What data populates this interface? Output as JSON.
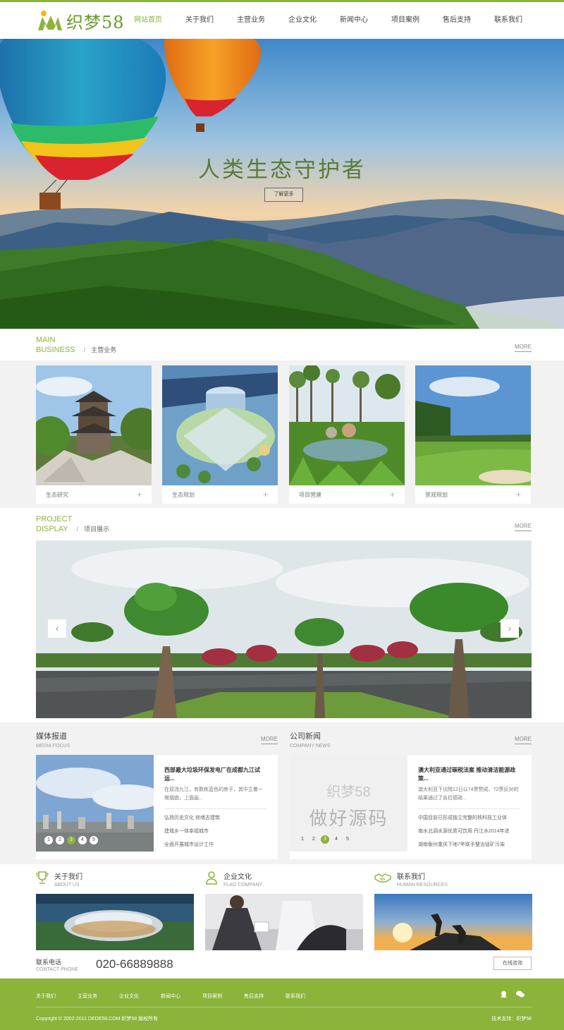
{
  "header": {
    "logo_text": "织梦58",
    "nav": [
      "网站首页",
      "关于我们",
      "主营业务",
      "企业文化",
      "新闻中心",
      "项目案例",
      "售后支持",
      "联系我们"
    ]
  },
  "hero": {
    "title": "人类生态守护者",
    "button": "了解更多"
  },
  "business": {
    "en_line1": "MAIN",
    "en_line2": "BUSINESS",
    "sep": "/",
    "cn": "主营业务",
    "more": "MORE",
    "cards": [
      {
        "label": "生态研究",
        "plus": "+"
      },
      {
        "label": "生态规划",
        "plus": "+"
      },
      {
        "label": "项目营建",
        "plus": "+"
      },
      {
        "label": "景观规划",
        "plus": "+"
      }
    ]
  },
  "project": {
    "en_line1": "PROJECT",
    "en_line2": "DISPLAY",
    "sep": "/",
    "cn": "项目展示",
    "more": "MORE",
    "prev": "‹",
    "next": "›"
  },
  "media": {
    "title": "媒体报道",
    "en": "MEDIA FOCUS",
    "more": "MORE",
    "pages": [
      "1",
      "2",
      "3",
      "4",
      "5"
    ],
    "headline": "西部最大垃圾环保发电厂在成都九江试运...",
    "desc": "在双流九江，有数栋蓝色的房子，其中立着一根烟囱，上面画...",
    "list": [
      "弘扬历史文化 修缮古建筑",
      "建城乡一体幸福城市",
      "全面开展城市设计工作"
    ]
  },
  "company_news": {
    "title": "公司新闻",
    "en": "COMPANY NEWS",
    "more": "MORE",
    "watermark1": "织梦58",
    "watermark2": "做好源码",
    "pages": [
      "1",
      "2",
      "3",
      "4",
      "5"
    ],
    "headline": "澳大利亚通过碳税法案 推动清洁能源政策...",
    "desc": "澳大利亚下议院12日以74票赞成、72票反对的结果通过了吉拉德政...",
    "list": [
      "中国目前已形成独立完整的核科技工业体",
      "南水北调水源优质可饮用 丹江水2014年进",
      "湖南衡州重庆下地7年联手整治锰矿污染"
    ]
  },
  "about": [
    {
      "cn": "关于我们",
      "en": "ABOUT US"
    },
    {
      "cn": "企业文化",
      "en": "FLAG COMPANY"
    },
    {
      "cn": "联系我们",
      "en": "HUMAN RESOURCES"
    }
  ],
  "contact": {
    "label": "联系电话",
    "label_en": "CONTACT PHONE",
    "phone": "020-66889888",
    "button": "在线咨询"
  },
  "footer": {
    "links": [
      "关于我们",
      "主营业务",
      "企业文化",
      "新闻中心",
      "项目案例",
      "售后支持",
      "联系我们"
    ],
    "copyright": "Copyright © 2002-2011 DEDE58.COM 织梦58 版权所有",
    "tech": "技术支持：织梦58"
  },
  "colors": {
    "accent": "#8cb33a",
    "footer": "#8cb33a"
  }
}
